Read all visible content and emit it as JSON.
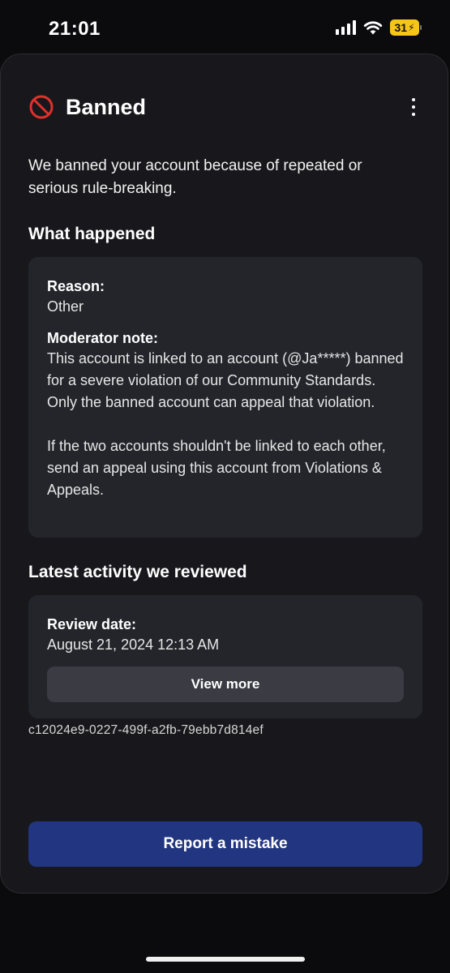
{
  "status_bar": {
    "time": "21:01",
    "battery": "31"
  },
  "header": {
    "title": "Banned",
    "icon": "ban-icon",
    "menu_icon": "more-vertical-icon"
  },
  "intro": "We banned your account because of repeated or serious rule-breaking.",
  "what_happened": {
    "heading": "What happened",
    "reason_label": "Reason:",
    "reason_value": "Other",
    "note_label": "Moderator note:",
    "note_value": "This account is linked to an account (@Ja*****) banned for a severe violation of our Community Standards. Only the banned account can appeal that violation.\n\nIf the two accounts shouldn't be linked to each other, send an appeal using this account from Violations & Appeals."
  },
  "latest_activity": {
    "heading": "Latest activity we reviewed",
    "review_label": "Review date:",
    "review_value": "August 21, 2024 12:13 AM",
    "view_more_label": "View more"
  },
  "reference_id": "c12024e9-0227-499f-a2fb-79ebb7d814ef",
  "report_button_label": "Report a mistake",
  "colors": {
    "ban_red": "#e0302b",
    "primary_button": "#223580",
    "battery": "#f5c518"
  }
}
